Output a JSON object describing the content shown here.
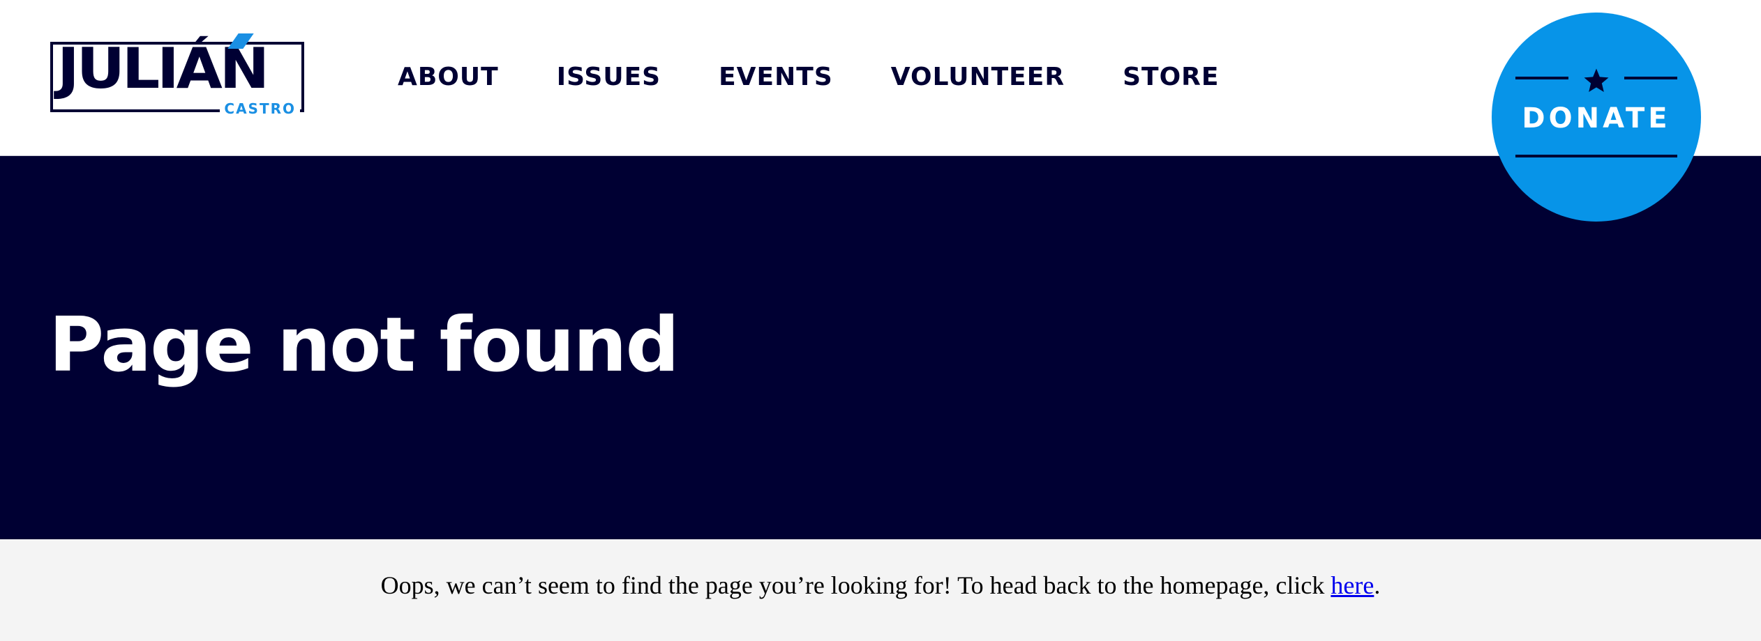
{
  "header": {
    "logo": {
      "name": "JULIÁN",
      "surname": "CASTRO"
    },
    "nav": [
      {
        "label": "ABOUT"
      },
      {
        "label": "ISSUES"
      },
      {
        "label": "EVENTS"
      },
      {
        "label": "VOLUNTEER"
      },
      {
        "label": "STORE"
      }
    ],
    "donate": {
      "label": "DONATE",
      "icon": "star-icon"
    }
  },
  "hero": {
    "title": "Page not found"
  },
  "message": {
    "before_link": "Oops, we can’t seem to find the page you’re looking for! To head back to the homepage, click ",
    "link_label": "here",
    "after_link": "."
  },
  "colors": {
    "navy": "#000033",
    "blue": "#0794e8",
    "accent_blue": "#1a8fe3",
    "band_gray": "#f4f4f4",
    "link": "#0000ee"
  }
}
